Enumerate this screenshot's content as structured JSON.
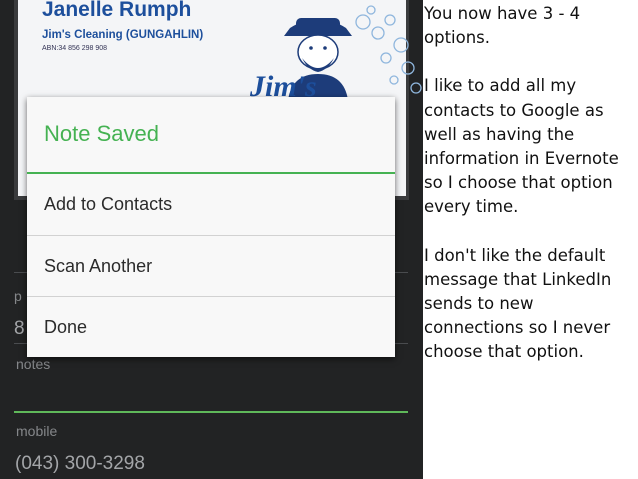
{
  "business_card": {
    "name": "Janelle Rumph",
    "company": "Jim's Cleaning (GUNGAHLIN)",
    "abn": "ABN:34 856 298 908",
    "logo_text": "Jim's"
  },
  "form": {
    "partial_label": "p",
    "partial_value": "8",
    "notes_label": "notes",
    "mobile_label": "mobile",
    "mobile_value": "(043) 300-3298"
  },
  "dialog": {
    "title": "Note Saved",
    "options": [
      "Add to Contacts",
      "Scan Another",
      "Done"
    ]
  },
  "commentary": {
    "para1": "You now have 3 - 4 options.",
    "para2": "I like to add all my contacts to Google as well as having the information in Evernote so I choose that option every time.",
    "para3": "I don't like the default message that LinkedIn sends to new connections so I never choose that option."
  },
  "colors": {
    "accent": "#45b252",
    "card_text": "#1d4f9c",
    "phone_bg": "#222324"
  }
}
